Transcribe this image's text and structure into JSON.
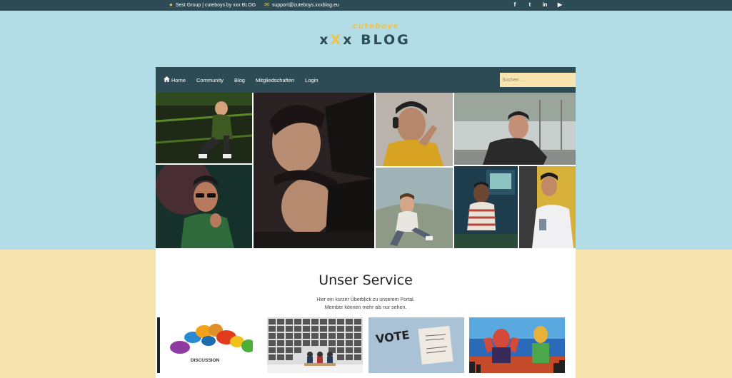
{
  "topbar": {
    "address": "Sest Group | cuteboys by xxx BLOG",
    "email": "support@cuteboys.xxxblog.eu",
    "social": [
      "f",
      "t",
      "in",
      "yt"
    ]
  },
  "logo": {
    "small": "cuteboys",
    "big_x1": "x",
    "big_x2": "X",
    "big_x3": "x",
    "big_word": "BLOG"
  },
  "nav": {
    "items": [
      {
        "label": "Home",
        "icon": "home-icon"
      },
      {
        "label": "Community"
      },
      {
        "label": "Blog"
      },
      {
        "label": "Mitgliedschaften"
      },
      {
        "label": "Login"
      }
    ],
    "search_placeholder": "Suchen …"
  },
  "service": {
    "title": "Unser Service",
    "line1": "Hier ein kurzer Überblick zu unserem Portal.",
    "line2": "Member können mehr als nur sehen."
  },
  "cards": {
    "discussion_label": "DISCUSSION",
    "vote_label": "VOTE"
  },
  "colors": {
    "dark": "#2d4b54",
    "accent": "#f0c24a",
    "sky": "#b2dce6",
    "sand": "#f8e4ae"
  }
}
